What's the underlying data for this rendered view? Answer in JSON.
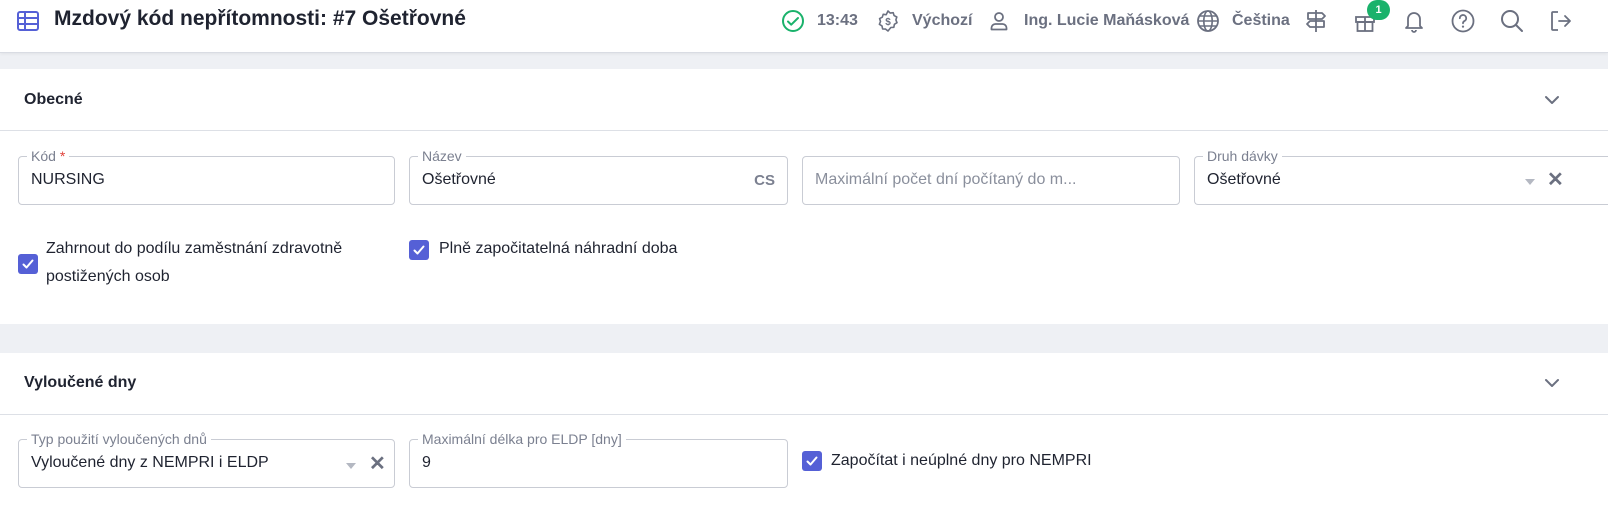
{
  "header": {
    "title": "Mzdový kód nepřítomnosti: #7 Ošetřovné",
    "time": "13:43",
    "currency": "Výchozí",
    "user": "Ing. Lucie Maňásková",
    "language": "Čeština",
    "notification_count": "1"
  },
  "general": {
    "title": "Obecné",
    "code": {
      "label": "Kód",
      "required_mark": "*",
      "value": "NURSING"
    },
    "name": {
      "label": "Název",
      "value": "Ošetřovné",
      "suffix": "CS"
    },
    "max_days": {
      "placeholder": "Maximální počet dní počítaný do m..."
    },
    "benefit_type": {
      "label": "Druh dávky",
      "value": "Ošetřovné"
    },
    "include_disabled": {
      "label_line1": "Zahrnout do podílu zaměstnání zdravotně",
      "label_line2": "postižených osob",
      "checked": true
    },
    "fully_creditable": {
      "label": "Plně započitatelná náhradní doba",
      "checked": true
    }
  },
  "excluded": {
    "title": "Vyloučené dny",
    "usage_type": {
      "label": "Typ použití vyloučených dnů",
      "value": "Vyloučené dny z NEMPRI i ELDP"
    },
    "max_eldp": {
      "label": "Maximální délka pro ELDP [dny]",
      "value": "9"
    },
    "count_partial": {
      "label": "Započítat i neúplné dny pro NEMPRI",
      "checked": true
    }
  },
  "colors": {
    "accent": "#5560d6",
    "success": "#1ab26b",
    "required": "#e0413a"
  }
}
